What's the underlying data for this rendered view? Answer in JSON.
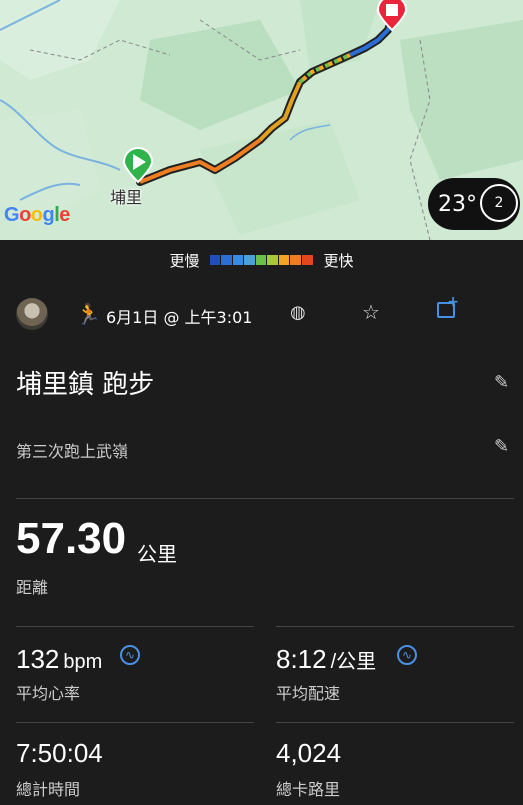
{
  "map": {
    "town_label": "埔里",
    "google_logo": "Google",
    "weather": {
      "temperature": "23°",
      "wind": "2"
    }
  },
  "pace_legend": {
    "slow_label": "更慢",
    "fast_label": "更快",
    "colors": [
      "#1f4fb8",
      "#2b6fd6",
      "#3a8be0",
      "#4aa0d8",
      "#6cbf4a",
      "#a8c83a",
      "#f2a623",
      "#ef7d22",
      "#e2471f"
    ]
  },
  "activity": {
    "date": "6月1日 @ 上午3:01",
    "title": "埔里鎮 跑步",
    "description": "第三次跑上武嶺"
  },
  "stats": {
    "distance": {
      "value": "57.30",
      "unit": "公里",
      "label": "距離"
    },
    "heart_rate": {
      "value": "132",
      "unit": "bpm",
      "label": "平均心率"
    },
    "pace": {
      "value": "8:12",
      "unit": "/公里",
      "label": "平均配速"
    },
    "total_time": {
      "value": "7:50:04",
      "label": "總計時間"
    },
    "calories": {
      "value": "4,024",
      "label": "總卡路里"
    }
  }
}
